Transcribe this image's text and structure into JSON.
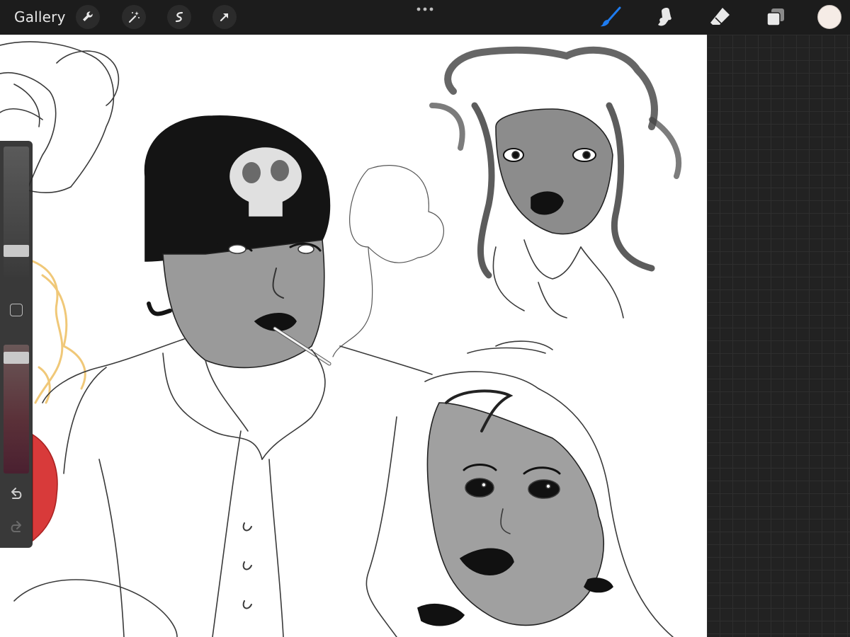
{
  "app": {
    "gallery_label": "Gallery"
  },
  "toolbar": {
    "left_buttons": [
      "wrench-icon",
      "magic-wand-icon",
      "selection-icon",
      "transform-arrow-icon"
    ],
    "more_icon": "ellipsis-icon",
    "right_tools": [
      "brush-icon",
      "smudge-icon",
      "eraser-icon",
      "layers-icon"
    ],
    "active_tool": "brush-icon",
    "active_tool_color": "#1e7cf0",
    "current_color": "#f5ece6"
  },
  "sidebar": {
    "brush_size": 0.17,
    "opacity": 0.06,
    "modify_button_icon": "square-icon",
    "undo_icon": "undo-icon",
    "redo_icon": "redo-icon"
  },
  "colors": {
    "toolbar_bg": "#1c1c1c",
    "canvas_bg": "#ffffff",
    "workspace_bg": "#222222"
  }
}
